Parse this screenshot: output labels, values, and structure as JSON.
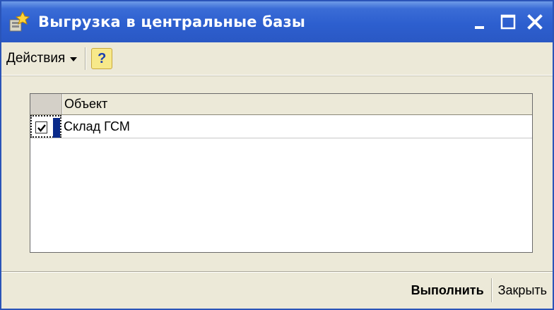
{
  "window": {
    "title": "Выгрузка в центральные базы",
    "icon": "settings-app-icon",
    "controls": {
      "minimize_icon": "minimize-icon",
      "maximize_icon": "maximize-icon",
      "close_icon": "close-icon"
    }
  },
  "toolbar": {
    "actions_label": "Действия",
    "actions_icon": "chevron-down-icon",
    "help_label": "?"
  },
  "table": {
    "columns": [
      "Объект"
    ],
    "rows": [
      {
        "checked": true,
        "object": "Склад ГСМ"
      }
    ]
  },
  "footer": {
    "execute_label": "Выполнить",
    "close_label": "Закрыть"
  },
  "colors": {
    "titlebar": "#2d5fcf",
    "window_bg": "#ece9d8",
    "selection": "#0a2a8a"
  }
}
